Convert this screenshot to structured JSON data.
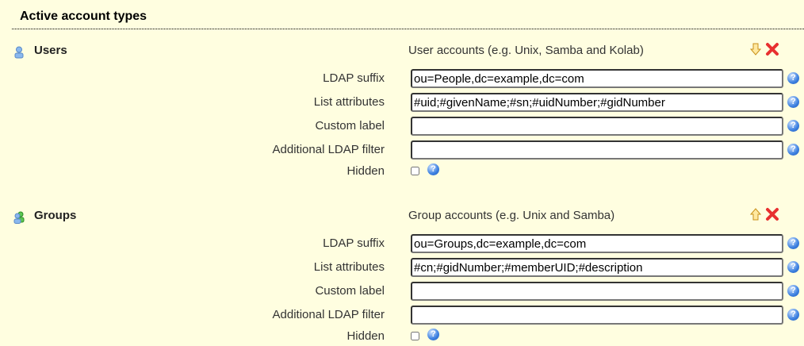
{
  "title": "Active account types",
  "sections": [
    {
      "name": "Users",
      "description": "User accounts (e.g. Unix, Samba and Kolab)",
      "icon": "user-icon",
      "move": "arrow-down-icon",
      "fields": {
        "ldap_suffix_label": "LDAP suffix",
        "ldap_suffix": "ou=People,dc=example,dc=com",
        "list_attributes_label": "List attributes",
        "list_attributes": "#uid;#givenName;#sn;#uidNumber;#gidNumber",
        "custom_label_label": "Custom label",
        "custom_label": "",
        "filter_label": "Additional LDAP filter",
        "filter": "",
        "hidden_label": "Hidden",
        "hidden": false
      }
    },
    {
      "name": "Groups",
      "description": "Group accounts (e.g. Unix and Samba)",
      "icon": "group-icon",
      "move": "arrow-up-icon",
      "fields": {
        "ldap_suffix_label": "LDAP suffix",
        "ldap_suffix": "ou=Groups,dc=example,dc=com",
        "list_attributes_label": "List attributes",
        "list_attributes": "#cn;#gidNumber;#memberUID;#description",
        "custom_label_label": "Custom label",
        "custom_label": "",
        "filter_label": "Additional LDAP filter",
        "filter": "",
        "hidden_label": "Hidden",
        "hidden": false
      }
    }
  ],
  "help_glyph": "?"
}
